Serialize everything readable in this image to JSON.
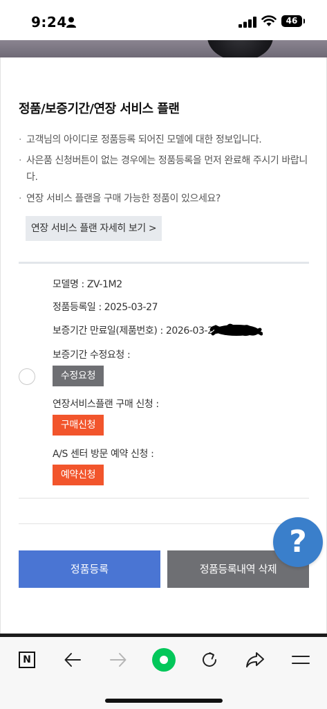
{
  "status": {
    "time": "9:24",
    "battery": "46"
  },
  "section": {
    "title": "정품/보증기간/연장 서비스 플랜"
  },
  "notices": [
    "고객님의 아이디로 정품등록 되어진 모델에 대한 정보입니다.",
    "사은품 신청버튼이 없는 경우에는 정품등록을 먼저 완료해 주시기 바랍니다.",
    "연장 서비스 플랜을 구매 가능한 정품이 있으세요?"
  ],
  "detail_link": "연장 서비스 플랜 자세히 보기 >",
  "product": {
    "model_label": "모델명 :",
    "model_value": "ZV-1M2",
    "reg_label": "정품등록일 :",
    "reg_value": "2025-03-27",
    "expiry_label": "보증기간 만료일(제품번호) :",
    "expiry_value": "2026-03-26",
    "warranty_request_label": "보증기간 수정요청 :",
    "warranty_request_button": "수정요청",
    "plan_label": "연장서비스플랜 구매 신청 :",
    "plan_button": "구매신청",
    "as_label": "A/S 센터 방문 예약 신청 :",
    "as_button": "예약신청"
  },
  "actions": {
    "register": "정품등록",
    "delete": "정품등록내역 삭제"
  },
  "help": "?",
  "toolbar": {
    "n_label": "N"
  },
  "colors": {
    "primary_blue": "#4a75d3",
    "gray_button": "#6e6f73",
    "orange_button": "#f2552c",
    "help_blue": "#3a7fcb",
    "naver_green": "#03c75a"
  },
  "icons": [
    "person-icon",
    "signal-icon",
    "wifi-icon",
    "battery-icon",
    "n-icon",
    "back-arrow-icon",
    "forward-arrow-icon",
    "green-dot-icon",
    "reload-icon",
    "share-icon",
    "menu-icon"
  ]
}
